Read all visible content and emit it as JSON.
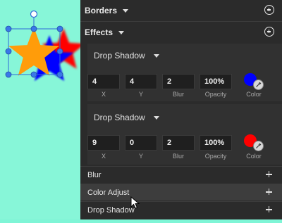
{
  "sections": {
    "borders": {
      "label": "Borders"
    },
    "effects": {
      "label": "Effects"
    }
  },
  "effects": [
    {
      "title": "Drop Shadow",
      "x": "4",
      "y": "4",
      "blur": "2",
      "opacity": "100%",
      "color": "#0000ff"
    },
    {
      "title": "Drop Shadow",
      "x": "9",
      "y": "0",
      "blur": "2",
      "opacity": "100%",
      "color": "#ff0000"
    }
  ],
  "field_labels": {
    "x": "X",
    "y": "Y",
    "blur": "Blur",
    "opacity": "Opacity",
    "color": "Color"
  },
  "add_list": [
    {
      "label": "Blur"
    },
    {
      "label": "Color Adjust"
    },
    {
      "label": "Drop Shadow"
    }
  ],
  "canvas": {
    "background": "#87f6d8",
    "star_fill": "#ff9c0a",
    "shadow_colors": [
      "#0000ff",
      "#ff0000"
    ]
  },
  "icons": {
    "section_add": "plus-circle-icon",
    "row_add": "plus-icon",
    "dropdown": "caret-down-icon",
    "eyedropper": "eyedropper-icon",
    "cursor": "mouse-pointer-icon"
  }
}
